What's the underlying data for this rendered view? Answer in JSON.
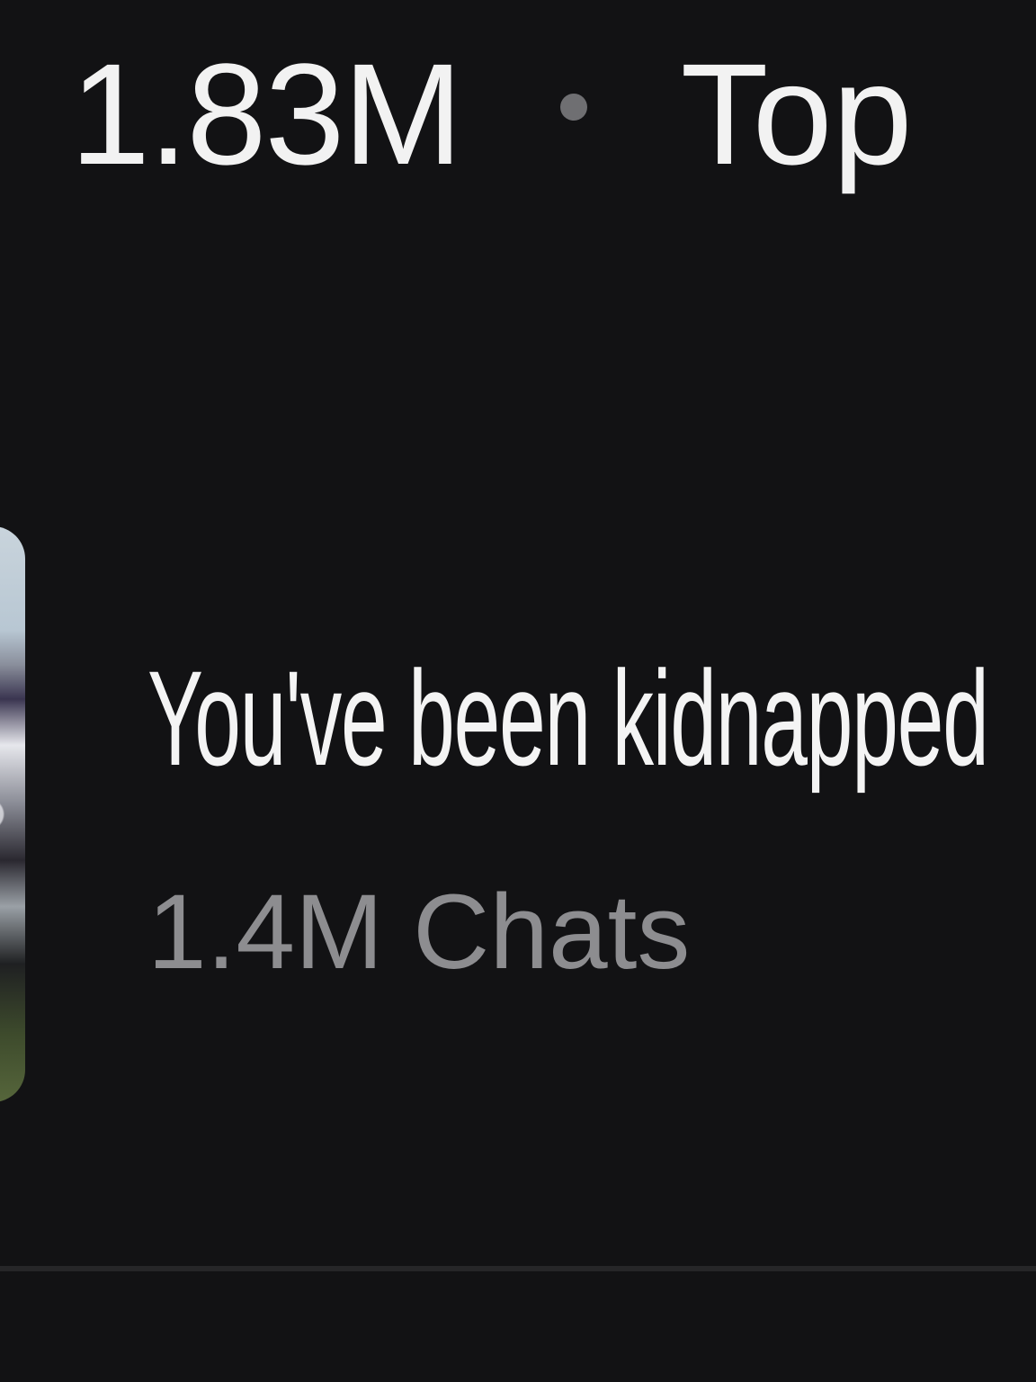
{
  "header": {
    "stat_value": "1.83M",
    "separator": "•",
    "tab_label": "Top"
  },
  "card": {
    "thumbnail_icon": "character-thumbnail",
    "title": "You've been kidnapped",
    "meta": "1.4M Chats"
  },
  "colors": {
    "background": "#121214",
    "text_primary": "#f2f2f2",
    "text_secondary": "#8d8d90",
    "dot": "#6f6f72",
    "divider": "#262628"
  }
}
